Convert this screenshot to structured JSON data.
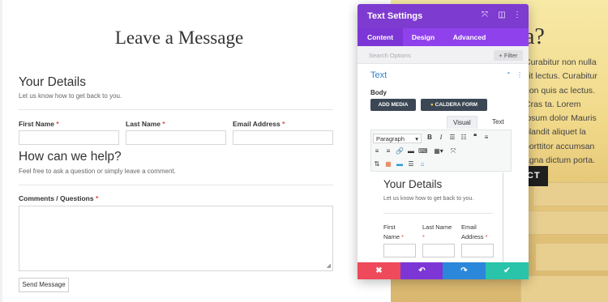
{
  "form": {
    "title": "Leave a Message",
    "details_title": "Your Details",
    "details_sub": "Let us know how to get back to you.",
    "first_name": "First Name",
    "last_name": "Last Name",
    "email": "Email Address",
    "required": "*",
    "help_title": "How can we help?",
    "help_sub": "Feel free to ask a question or simply leave a comment.",
    "comments": "Comments / Questions",
    "send": "Send Message"
  },
  "right": {
    "heading": "a?",
    "body": "Curabitur non nulla sit lectus. Curabitur non quis ac lectus. Cras ta. Lorem ipsum dolor Mauris blandit aliquet la porttitor accumsan agna dictum porta.",
    "button": "CT"
  },
  "panel": {
    "title": "Text Settings",
    "tabs": [
      "Content",
      "Design",
      "Advanced"
    ],
    "search_placeholder": "Search Options",
    "filter": "+ Filter",
    "group": "Text",
    "body_label": "Body",
    "add_media": "ADD MEDIA",
    "caldera": "CALDERA FORM",
    "visual": "Visual",
    "text": "Text",
    "paragraph": "Paragraph",
    "preview": {
      "title": "Your Details",
      "sub": "Let us know how to get back to you.",
      "first": "First",
      "name": "Name",
      "last": "Last Name",
      "email": "Email",
      "address": "Address",
      "req": "*"
    },
    "colors": {
      "header": "#7e3bd0",
      "cancel": "#ef4a5b",
      "undo": "#7d36d6",
      "redo": "#2b87da",
      "save": "#29c4a9"
    }
  }
}
